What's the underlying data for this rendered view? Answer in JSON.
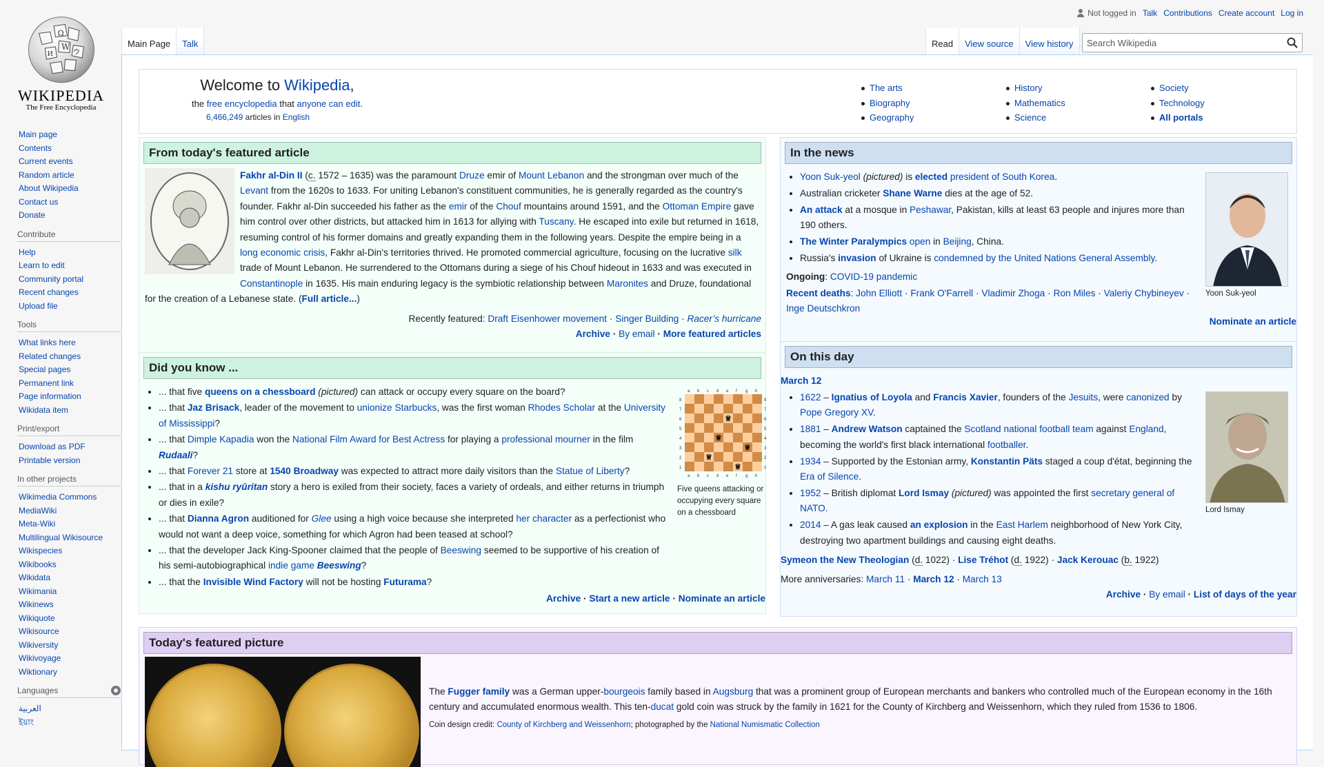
{
  "logo": {
    "wordmark": "WIKIPEDIA",
    "tagline": "The Free Encyclopedia"
  },
  "personal": {
    "not_logged": "Not logged in",
    "links": [
      "Talk",
      "Contributions",
      "Create account",
      "Log in"
    ]
  },
  "tabs_left": [
    "Main Page",
    "Talk"
  ],
  "tabs_right": [
    "Read",
    "View source",
    "View history"
  ],
  "search": {
    "placeholder": "Search Wikipedia"
  },
  "sidebar": {
    "main": [
      "Main page",
      "Contents",
      "Current events",
      "Random article",
      "About Wikipedia",
      "Contact us",
      "Donate"
    ],
    "contribute": {
      "title": "Contribute",
      "items": [
        "Help",
        "Learn to edit",
        "Community portal",
        "Recent changes",
        "Upload file"
      ]
    },
    "tools": {
      "title": "Tools",
      "items": [
        "What links here",
        "Related changes",
        "Special pages",
        "Permanent link",
        "Page information",
        "Wikidata item"
      ]
    },
    "print": {
      "title": "Print/export",
      "items": [
        "Download as PDF",
        "Printable version"
      ]
    },
    "projects": {
      "title": "In other projects",
      "items": [
        "Wikimedia Commons",
        "MediaWiki",
        "Meta-Wiki",
        "Multilingual Wikisource",
        "Wikispecies",
        "Wikibooks",
        "Wikidata",
        "Wikimania",
        "Wikinews",
        "Wikiquote",
        "Wikisource",
        "Wikiversity",
        "Wikivoyage",
        "Wiktionary"
      ]
    },
    "languages": {
      "title": "Languages",
      "items": [
        "العربية",
        "ইয়াং"
      ]
    }
  },
  "welcome": {
    "welcome": "Welcome to ",
    "wikipedia": "Wikipedia",
    "comma": ",",
    "the": "the ",
    "free_encyclopedia": "free encyclopedia",
    "that": " that ",
    "anyone": "anyone can edit",
    "dot": ".",
    "count": "6,466,249",
    "articles_in": " articles in ",
    "english": "English",
    "portals": [
      "The arts",
      "History",
      "Society",
      "Biography",
      "Mathematics",
      "Technology",
      "Geography",
      "Science",
      "All portals"
    ]
  },
  "tfa": {
    "title": "From today's featured article",
    "recently": "Recently featured:",
    "recent_links": [
      "Draft Eisenhower movement",
      "Singer Building",
      "Racer’s hurricane"
    ],
    "links": [
      "Archive",
      "By email",
      "More featured articles"
    ],
    "full": "Full article..."
  },
  "dyk": {
    "title": "Did you know ...",
    "caption": "Five queens attacking or occupying every square on a chessboard",
    "links": [
      "Archive",
      "Start a new article",
      "Nominate an article"
    ]
  },
  "itn": {
    "title": "In the news",
    "caption": "Yoon Suk-yeol",
    "nominate": "Nominate an article"
  },
  "otd": {
    "title": "On this day",
    "date": "March 12",
    "caption": "Lord Ismay",
    "more": "More anniversaries:",
    "more_links": [
      "March 11",
      "March 12",
      "March 13"
    ],
    "links": [
      "Archive",
      "By email",
      "List of days of the year"
    ]
  },
  "tfp": {
    "title": "Today's featured picture",
    "credit_label": "Coin design credit: ",
    "credit_link": "County of Kirchberg and Weissenhorn",
    "photo_label": "; photographed by the ",
    "photo_link": "National Numismatic Collection"
  },
  "colors": {
    "link": "#0645ad",
    "tfa_head": "#cef2e0",
    "itn_head": "#cedff2",
    "tfp_head": "#ddcef2"
  }
}
